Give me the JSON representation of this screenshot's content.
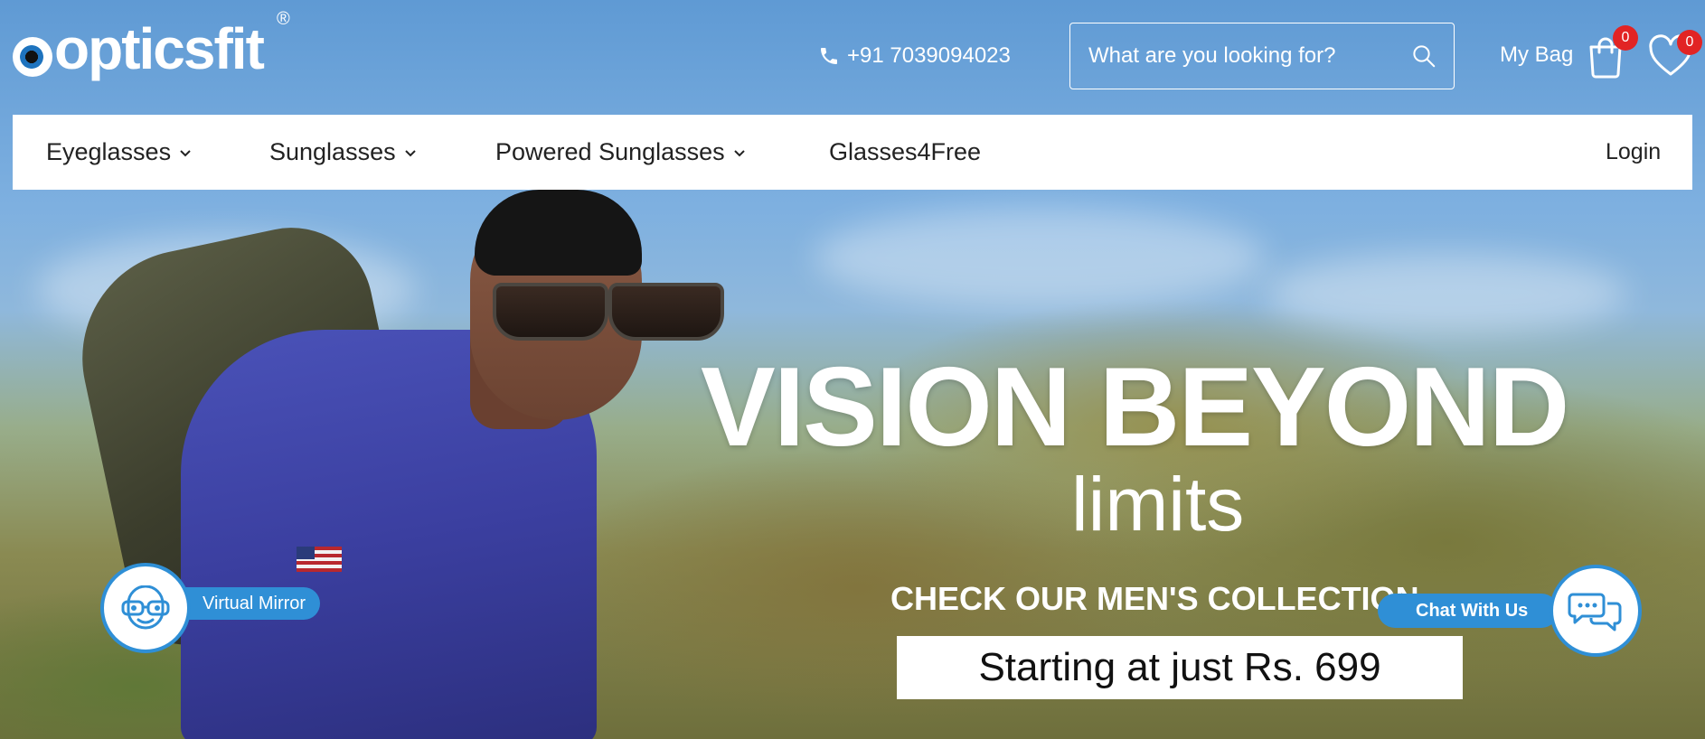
{
  "brand": {
    "name": "opticsfit",
    "registered": "®"
  },
  "header": {
    "phone": "+91 7039094023",
    "search_placeholder": "What are you looking for?",
    "bag_label": "My Bag",
    "bag_count": "0",
    "wishlist_count": "0"
  },
  "nav": {
    "items": [
      {
        "label": "Eyeglasses",
        "has_dropdown": true
      },
      {
        "label": "Sunglasses",
        "has_dropdown": true
      },
      {
        "label": "Powered Sunglasses",
        "has_dropdown": true
      },
      {
        "label": "Glasses4Free",
        "has_dropdown": false
      }
    ],
    "login": "Login"
  },
  "hero": {
    "headline": "VISION BEYOND",
    "subheadline": "limits",
    "collection": "CHECK OUR MEN'S COLLECTION",
    "price": "Starting at just Rs. 699"
  },
  "widgets": {
    "virtual_mirror": "Virtual Mirror",
    "chat": "Chat With Us"
  },
  "colors": {
    "accent_blue": "#2f8fd6",
    "badge_red": "#e22424",
    "nav_bg": "#ffffff"
  },
  "icons": [
    "phone-icon",
    "search-icon",
    "bag-icon",
    "heart-icon",
    "chevron-down-icon",
    "glasses-face-icon",
    "chat-bubbles-icon"
  ]
}
